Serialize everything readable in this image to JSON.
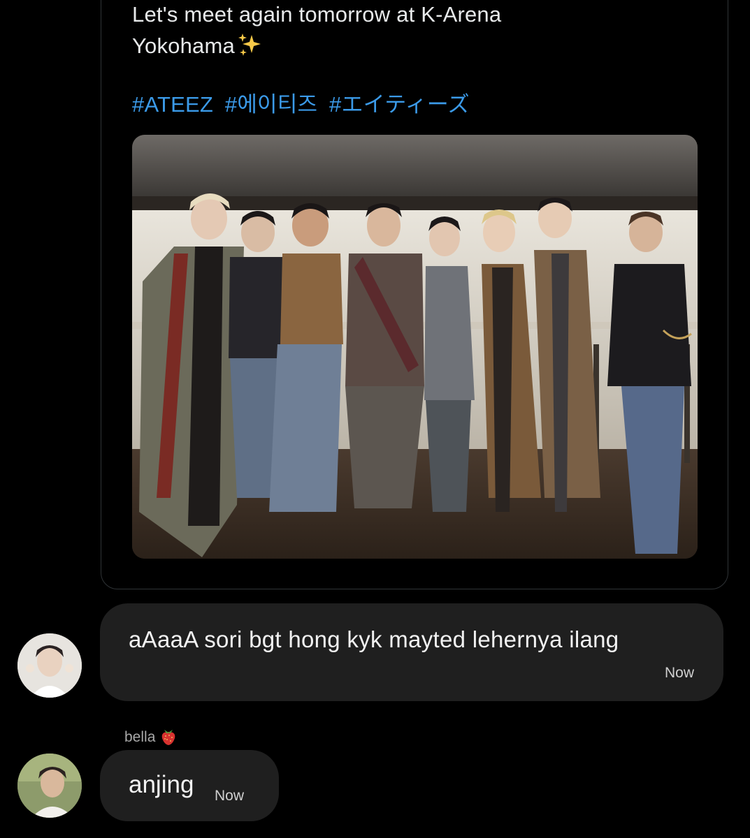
{
  "shared_post": {
    "text_lines": [
      "Let's meet again tomorrow at K-Arena",
      "Yokohama"
    ],
    "emoji": "sparkles-icon",
    "hashtags": [
      "#ATEEZ",
      "#에이티즈",
      "#エイティーズ"
    ],
    "photo": "group-photo"
  },
  "messages": [
    {
      "avatar": "avatar-photo",
      "text": "aAaaA sori bgt hong kyk mayted lehernya ilang",
      "time": "Now"
    },
    {
      "sender": "bella",
      "sender_emoji": "strawberry-icon",
      "avatar": "avatar-photo",
      "text": "anjing",
      "time": "Now"
    }
  ],
  "colors": {
    "background": "#000000",
    "bubble": "#1f1f1f",
    "hashtag": "#3b9ae8",
    "card_border": "#2f3336"
  }
}
